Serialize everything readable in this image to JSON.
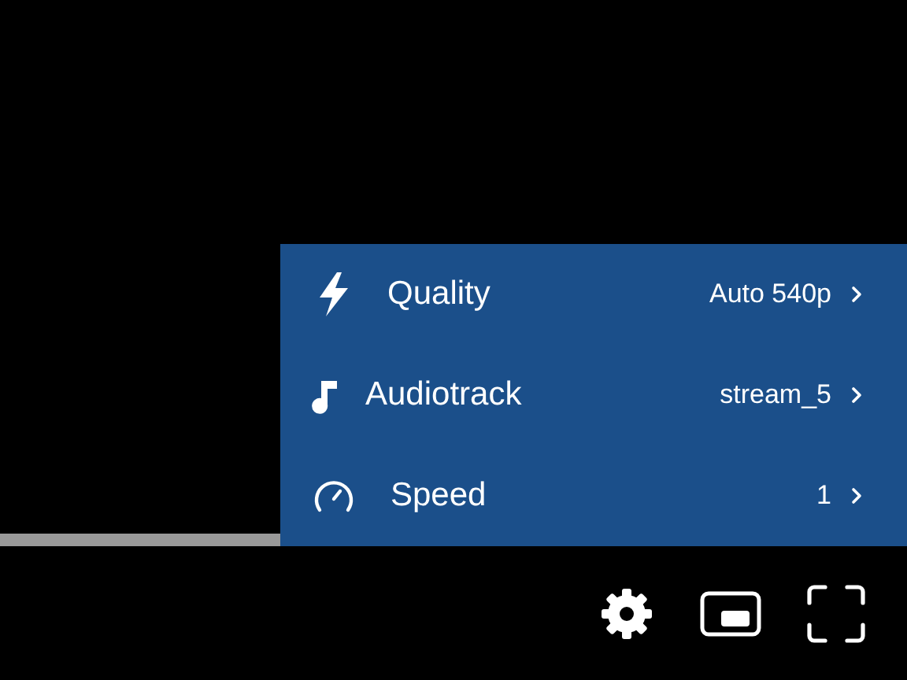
{
  "settings_menu": {
    "items": [
      {
        "label": "Quality",
        "value": "Auto 540p"
      },
      {
        "label": "Audiotrack",
        "value": "stream_5"
      },
      {
        "label": "Speed",
        "value": "1"
      }
    ]
  },
  "control_bar": {
    "settings_open": true
  }
}
